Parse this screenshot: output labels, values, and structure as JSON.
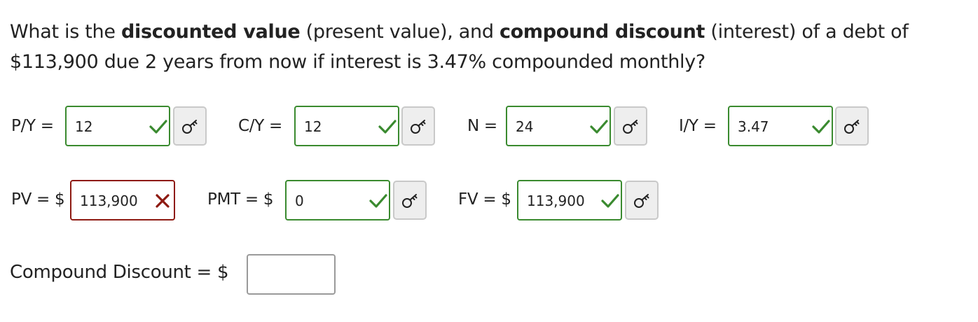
{
  "question": {
    "intro": "What is the ",
    "bold1": "discounted value",
    "mid1": " (present value), and ",
    "bold2": "compound discount",
    "rest": " (interest) of a debt of $113,900 due 2 years from now if interest is 3.47% compounded monthly?"
  },
  "fields": {
    "py": {
      "label": "P/Y =",
      "value": "12",
      "status": "correct"
    },
    "cy": {
      "label": "C/Y =",
      "value": "12",
      "status": "correct"
    },
    "n": {
      "label": "N =",
      "value": "24",
      "status": "correct"
    },
    "iy": {
      "label": "I/Y =",
      "value": "3.47",
      "status": "correct"
    },
    "pv": {
      "label": "PV = $",
      "value": "113,900",
      "status": "incorrect"
    },
    "pmt": {
      "label": "PMT = $",
      "value": "0",
      "status": "correct"
    },
    "fv": {
      "label": "FV = $",
      "value": "113,900",
      "status": "correct"
    },
    "compound_discount": {
      "label": "Compound Discount = $",
      "value": ""
    }
  },
  "icons": {
    "correct": "checkmark-icon",
    "incorrect": "x-mark-icon",
    "key": "key-icon"
  },
  "colors": {
    "correct": "#3a8a2f",
    "incorrect": "#8e1a12",
    "neutral_border": "#9a9a9a"
  }
}
